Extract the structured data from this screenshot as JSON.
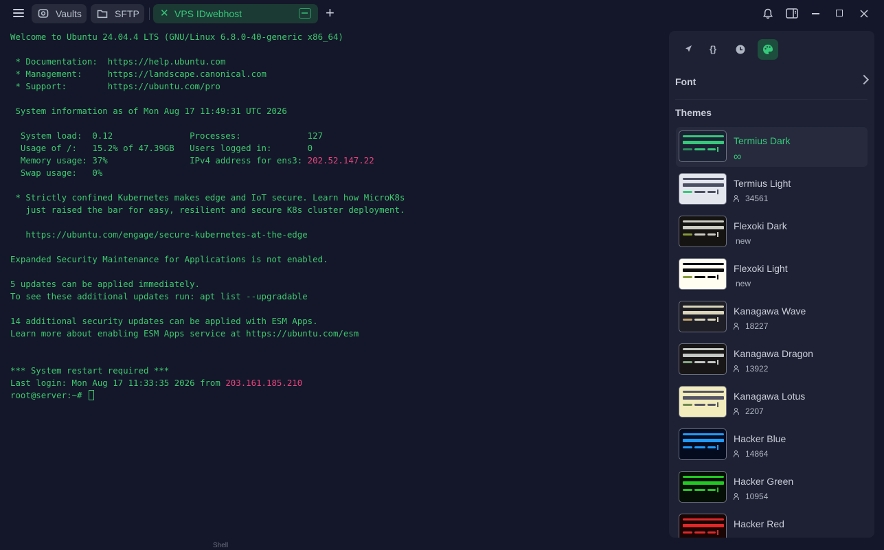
{
  "tabs": [
    {
      "label": "Vaults",
      "icon": "vault-icon"
    },
    {
      "label": "SFTP",
      "icon": "folder-icon"
    },
    {
      "label": "VPS IDwebhost",
      "icon": "terminal-icon",
      "active": true
    }
  ],
  "terminal": {
    "lines": [
      "Welcome to Ubuntu 24.04.4 LTS (GNU/Linux 6.8.0-40-generic x86_64)",
      "",
      " * Documentation:  https://help.ubuntu.com",
      " * Management:     https://landscape.canonical.com",
      " * Support:        https://ubuntu.com/pro",
      "",
      " System information as of Mon Aug 17 11:49:31 UTC 2026",
      "",
      "  System load:  0.12               Processes:             127",
      "  Usage of /:   15.2% of 47.39GB   Users logged in:       0",
      "  Memory usage: 37%                IPv4 address for ens3: ",
      "  Swap usage:   0%",
      "",
      " * Strictly confined Kubernetes makes edge and IoT secure. Learn how MicroK8s",
      "   just raised the bar for easy, resilient and secure K8s cluster deployment.",
      "",
      "   https://ubuntu.com/engage/secure-kubernetes-at-the-edge",
      "",
      "Expanded Security Maintenance for Applications is not enabled.",
      "",
      "5 updates can be applied immediately.",
      "To see these additional updates run: apt list --upgradable",
      "",
      "14 additional security updates can be applied with ESM Apps.",
      "Learn more about enabling ESM Apps service at https://ubuntu.com/esm",
      "",
      "",
      "*** System restart required ***",
      "Last login: Mon Aug 17 11:33:35 2026 from ",
      "root@server:~# "
    ],
    "ipv4": "202.52.147.22",
    "last_login_ip": "203.161.185.210",
    "color": "#3ec970",
    "highlight_color": "#e8457f"
  },
  "panel": {
    "font_label": "Font",
    "themes_label": "Themes",
    "themes": [
      {
        "name": "Termius Dark",
        "meta": "∞",
        "selected": true,
        "bg": "#1b2233",
        "a": "#37c97b",
        "b": "#2b8f5e"
      },
      {
        "name": "Termius Light",
        "meta": "34561",
        "bg": "#e4e6ee",
        "a": "#4a4f63",
        "b": "#37c97b"
      },
      {
        "name": "Flexoki Dark",
        "meta": "new",
        "bg": "#151413",
        "a": "#cecdc3",
        "b": "#879a39"
      },
      {
        "name": "Flexoki Light",
        "meta": "new",
        "bg": "#fffcf0",
        "a": "#100f0f",
        "b": "#879a39"
      },
      {
        "name": "Kanagawa Wave",
        "meta": "18227",
        "bg": "#1f1f28",
        "a": "#dcd7ba",
        "b": "#c0a36e"
      },
      {
        "name": "Kanagawa Dragon",
        "meta": "13922",
        "bg": "#181616",
        "a": "#c5c9c5",
        "b": "#87a987"
      },
      {
        "name": "Kanagawa Lotus",
        "meta": "2207",
        "bg": "#f2ecbc",
        "a": "#545464",
        "b": "#6f894e"
      },
      {
        "name": "Hacker Blue",
        "meta": "14864",
        "bg": "#050b1f",
        "a": "#1e9bff",
        "b": "#1e9bff"
      },
      {
        "name": "Hacker Green",
        "meta": "10954",
        "bg": "#050f05",
        "a": "#22c922",
        "b": "#22c922"
      },
      {
        "name": "Hacker Red",
        "meta": "",
        "bg": "#1a0505",
        "a": "#e02828",
        "b": "#e02828"
      }
    ]
  },
  "bottom": {
    "peek_text": "Shell"
  }
}
